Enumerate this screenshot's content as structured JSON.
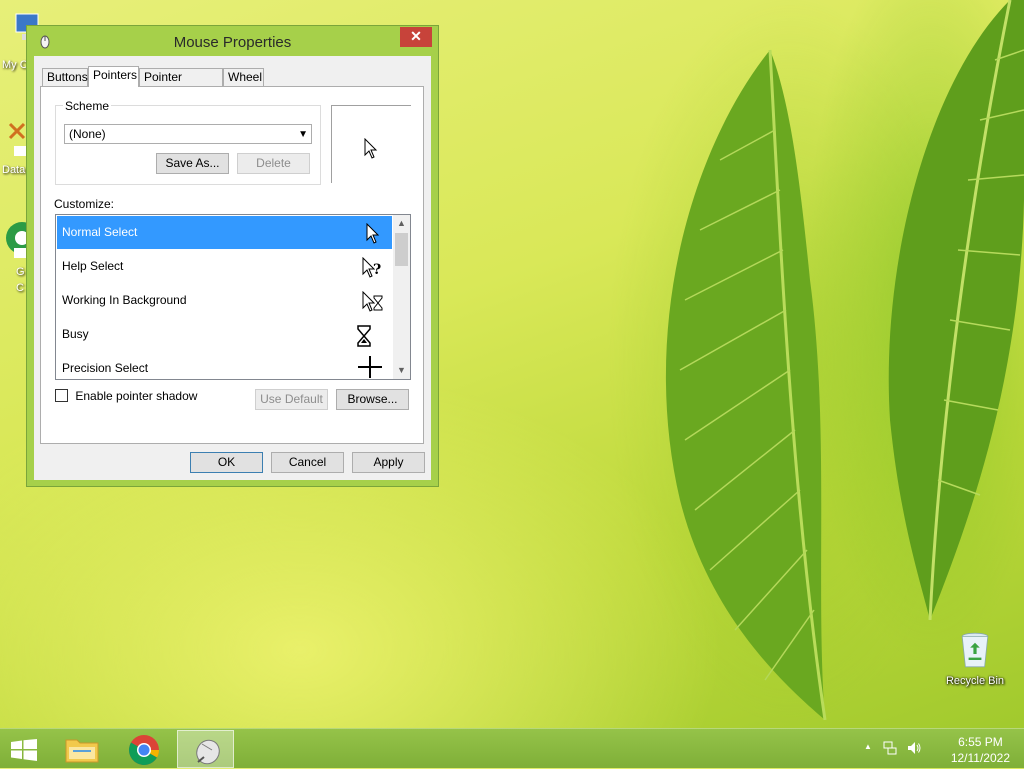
{
  "desktop": {
    "icons": [
      {
        "label": "Recycle Bin",
        "icon": "recycle-bin-icon"
      }
    ],
    "partial_labels": [
      "My C",
      "Data",
      "G",
      "C"
    ]
  },
  "window": {
    "title": "Mouse Properties",
    "close_label": "✕",
    "tabs": [
      {
        "label": "Buttons"
      },
      {
        "label": "Pointers",
        "active": true
      },
      {
        "label": "Pointer Options"
      },
      {
        "label": "Wheel"
      }
    ],
    "scheme": {
      "group_label": "Scheme",
      "selected": "(None)",
      "save_as_label": "Save As...",
      "delete_label": "Delete"
    },
    "customize": {
      "label": "Customize:",
      "items": [
        {
          "label": "Normal Select",
          "icon": "arrow-cursor-icon",
          "selected": true
        },
        {
          "label": "Help Select",
          "icon": "help-cursor-icon"
        },
        {
          "label": "Working In Background",
          "icon": "working-cursor-icon"
        },
        {
          "label": "Busy",
          "icon": "hourglass-cursor-icon"
        },
        {
          "label": "Precision Select",
          "icon": "crosshair-cursor-icon"
        }
      ]
    },
    "pointer_shadow_label": "Enable pointer shadow",
    "use_default_label": "Use Default",
    "browse_label": "Browse...",
    "ok_label": "OK",
    "cancel_label": "Cancel",
    "apply_label": "Apply"
  },
  "taskbar": {
    "clock_time": "6:55 PM",
    "clock_date": "12/11/2022",
    "tray_expand": "▲"
  },
  "colors": {
    "selection": "#3399ff",
    "close_button": "#c7433a",
    "window_frame": "#a6d04a"
  }
}
